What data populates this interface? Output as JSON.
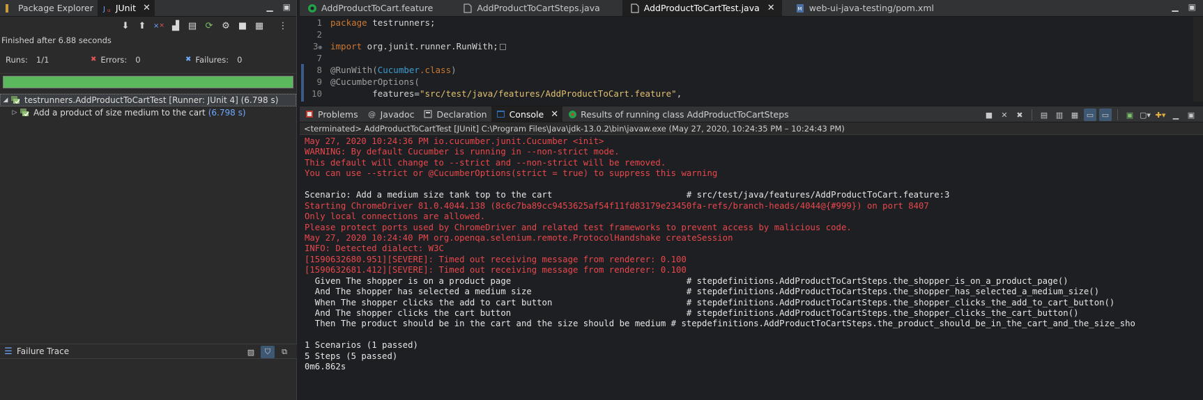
{
  "left_panel": {
    "tabs": [
      {
        "label": "Package Explorer",
        "icon": "package-explorer-icon"
      },
      {
        "label": "JUnit",
        "icon": "junit-icon"
      }
    ],
    "status": "Finished after 6.88 seconds",
    "runs_label": "Runs:",
    "runs_value": "1/1",
    "errors_label": "Errors:",
    "errors_value": "0",
    "failures_label": "Failures:",
    "failures_value": "0",
    "progress": 1.0,
    "progress_color": "#5cb85c",
    "tree": {
      "root_label": "testrunners.AddProductToCartTest [Runner: JUnit 4] (6.798 s)",
      "child_label": "Add a product of size medium to the cart",
      "child_time": "(6.798 s)"
    },
    "failure_trace_label": "Failure Trace"
  },
  "editor": {
    "tabs": [
      {
        "label": "AddProductToCart.feature",
        "icon": "cucumber-file-icon",
        "active": false
      },
      {
        "label": "AddProductToCartSteps.java",
        "icon": "java-file-icon",
        "active": false
      },
      {
        "label": "AddProductToCartTest.java",
        "icon": "java-file-icon",
        "active": true
      },
      {
        "label": "web-ui-java-testing/pom.xml",
        "icon": "maven-pom-icon",
        "active": false
      }
    ],
    "line_numbers": [
      "1",
      "2",
      "3",
      "7",
      "8",
      "9",
      "10"
    ],
    "line1_kw": "package",
    "line1_rest": " testrunners;",
    "line3_kw": "import",
    "line3_rest": " org.junit.runner.RunWith;",
    "line8_ann": "@RunWith(",
    "line8_cls": "Cucumber",
    "line8_kw": ".class",
    "line8_end": ")",
    "line9_ann": "@CucumberOptions(",
    "line10_key": "        features=",
    "line10_str": "\"src/test/java/features/AddProductToCart.feature\"",
    "line10_end": ","
  },
  "console_panel": {
    "tabs": [
      {
        "label": "Problems",
        "icon": "problems-icon"
      },
      {
        "label": "Javadoc",
        "icon": "javadoc-icon"
      },
      {
        "label": "Declaration",
        "icon": "declaration-icon"
      },
      {
        "label": "Console",
        "icon": "console-icon"
      },
      {
        "label": "Results of running class AddProductToCartSteps",
        "icon": "cucumber-results-icon"
      }
    ],
    "terminated": "<terminated> AddProductToCartTest [JUnit] C:\\Program Files\\Java\\jdk-13.0.2\\bin\\javaw.exe  (May 27, 2020, 10:24:35 PM – 10:24:43 PM)",
    "lines": [
      {
        "text": "May 27, 2020 10:24:36 PM io.cucumber.junit.Cucumber <init>",
        "color": "red"
      },
      {
        "text": "WARNING: By default Cucumber is running in --non-strict mode.",
        "color": "red"
      },
      {
        "text": "This default will change to --strict and --non-strict will be removed.",
        "color": "red"
      },
      {
        "text": "You can use --strict or @CucumberOptions(strict = true) to suppress this warning",
        "color": "red"
      },
      {
        "text": "",
        "color": "white"
      },
      {
        "text": "Scenario: Add a medium size tank top to the cart                          # src/test/java/features/AddProductToCart.feature:3",
        "color": "white"
      },
      {
        "text": "Starting ChromeDriver 81.0.4044.138 (8c6c7ba89cc9453625af54f11fd83179e23450fa-refs/branch-heads/4044@{#999}) on port 8407",
        "color": "red"
      },
      {
        "text": "Only local connections are allowed.",
        "color": "red"
      },
      {
        "text": "Please protect ports used by ChromeDriver and related test frameworks to prevent access by malicious code.",
        "color": "red"
      },
      {
        "text": "May 27, 2020 10:24:40 PM org.openqa.selenium.remote.ProtocolHandshake createSession",
        "color": "red"
      },
      {
        "text": "INFO: Detected dialect: W3C",
        "color": "red"
      },
      {
        "text": "[1590632680.951][SEVERE]: Timed out receiving message from renderer: 0.100",
        "color": "red"
      },
      {
        "text": "[1590632681.412][SEVERE]: Timed out receiving message from renderer: 0.100",
        "color": "red"
      },
      {
        "text": "  Given The shopper is on a product page                                  # stepdefinitions.AddProductToCartSteps.the_shopper_is_on_a_product_page()",
        "color": "white"
      },
      {
        "text": "  And The shopper has selected a medium size                              # stepdefinitions.AddProductToCartSteps.the_shopper_has_selected_a_medium_size()",
        "color": "white"
      },
      {
        "text": "  When The shopper clicks the add to cart button                          # stepdefinitions.AddProductToCartSteps.the_shopper_clicks_the_add_to_cart_button()",
        "color": "white"
      },
      {
        "text": "  And The shopper clicks the cart button                                  # stepdefinitions.AddProductToCartSteps.the_shopper_clicks_the_cart_button()",
        "color": "white"
      },
      {
        "text": "  Then The product should be in the cart and the size should be medium # stepdefinitions.AddProductToCartSteps.the_product_should_be_in_the_cart_and_the_size_sho",
        "color": "white"
      },
      {
        "text": "",
        "color": "white"
      },
      {
        "text": "1 Scenarios (1 passed)",
        "color": "white"
      },
      {
        "text": "5 Steps (5 passed)",
        "color": "white"
      },
      {
        "text": "0m6.862s",
        "color": "white"
      }
    ]
  }
}
